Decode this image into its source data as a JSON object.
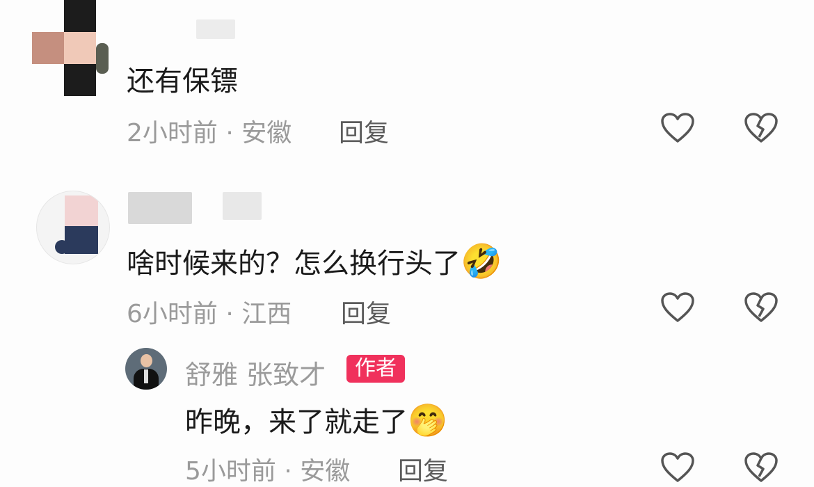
{
  "comments": [
    {
      "text": "还有保镖",
      "time_location": "2小时前 · 安徽",
      "reply_label": "回复"
    },
    {
      "text": "啥时候来的？怎么换行头了",
      "emoji": "🤣",
      "time_location": "6小时前 · 江西",
      "reply_label": "回复"
    }
  ],
  "author_reply": {
    "username": "舒雅  张致才",
    "badge": "作者",
    "text": "昨晚，来了就走了",
    "emoji": "🤭",
    "time_location": "5小时前 · 安徽",
    "reply_label": "回复"
  },
  "icons": {
    "like": "heart-outline-icon",
    "dislike": "broken-heart-icon"
  },
  "colors": {
    "badge": "#f0315c",
    "meta": "#9a9a9a"
  }
}
